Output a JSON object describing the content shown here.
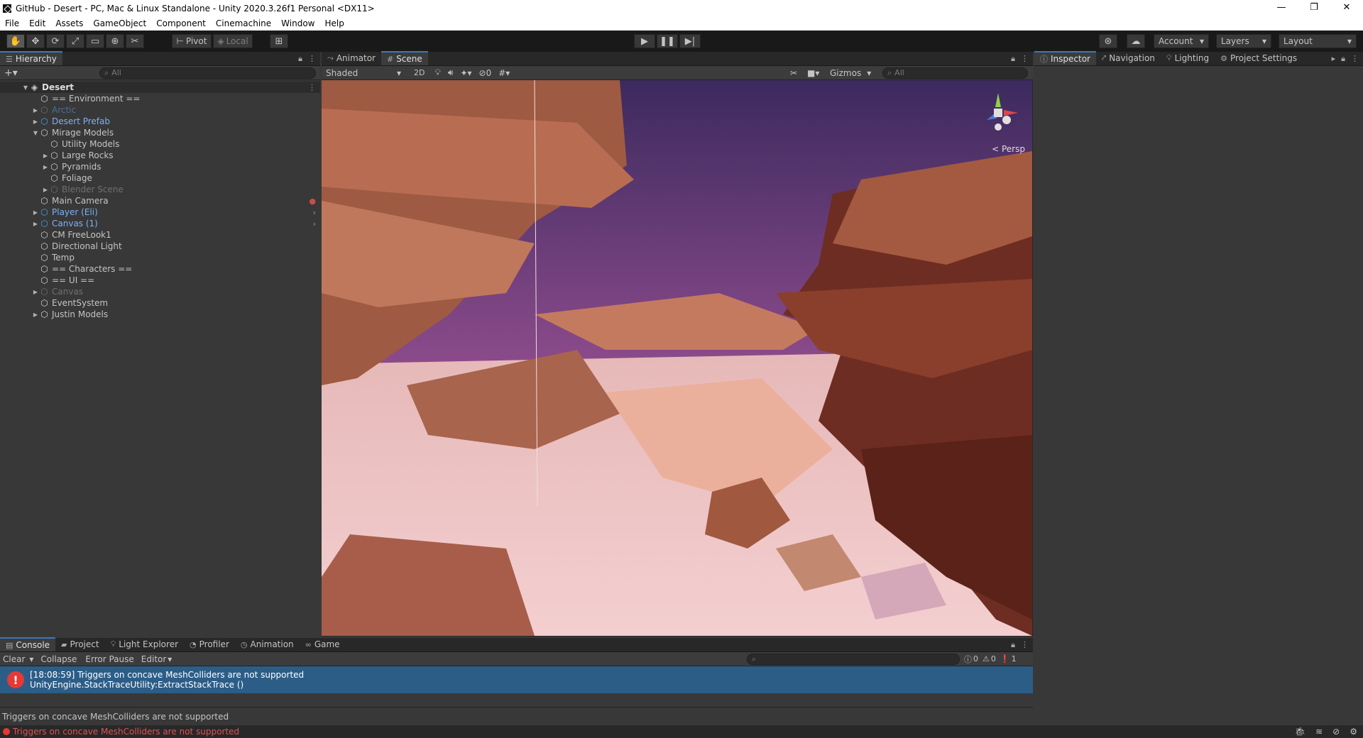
{
  "window": {
    "title": "GitHub - Desert - PC, Mac & Linux Standalone - Unity 2020.3.26f1 Personal <DX11>"
  },
  "menu": [
    "File",
    "Edit",
    "Assets",
    "GameObject",
    "Component",
    "Cinemachine",
    "Window",
    "Help"
  ],
  "toolbar": {
    "pivot": "Pivot",
    "local": "Local",
    "account": "Account",
    "layers": "Layers",
    "layout": "Layout"
  },
  "hierarchy": {
    "tab": "Hierarchy",
    "search_placeholder": "All",
    "scene": "Desert",
    "items": [
      {
        "label": "== Environment ==",
        "depth": 1,
        "arrow": "",
        "style": ""
      },
      {
        "label": "Arctic",
        "depth": 1,
        "arrow": "▶",
        "style": "faded blue"
      },
      {
        "label": "Desert Prefab",
        "depth": 1,
        "arrow": "▶",
        "style": "blue"
      },
      {
        "label": "Mirage Models",
        "depth": 1,
        "arrow": "▼",
        "style": ""
      },
      {
        "label": "Utility Models",
        "depth": 2,
        "arrow": "",
        "style": ""
      },
      {
        "label": "Large Rocks",
        "depth": 2,
        "arrow": "▶",
        "style": ""
      },
      {
        "label": "Pyramids",
        "depth": 2,
        "arrow": "▶",
        "style": ""
      },
      {
        "label": "Foliage",
        "depth": 2,
        "arrow": "",
        "style": ""
      },
      {
        "label": "Blender Scene",
        "depth": 2,
        "arrow": "▶",
        "style": "faded"
      },
      {
        "label": "Main Camera",
        "depth": 1,
        "arrow": "",
        "style": ""
      },
      {
        "label": "Player (Eli)",
        "depth": 1,
        "arrow": "▶",
        "style": "blue"
      },
      {
        "label": "Canvas (1)",
        "depth": 1,
        "arrow": "▶",
        "style": "blue"
      },
      {
        "label": "CM FreeLook1",
        "depth": 1,
        "arrow": "",
        "style": ""
      },
      {
        "label": "Directional Light",
        "depth": 1,
        "arrow": "",
        "style": ""
      },
      {
        "label": "Temp",
        "depth": 1,
        "arrow": "",
        "style": ""
      },
      {
        "label": "== Characters ==",
        "depth": 1,
        "arrow": "",
        "style": ""
      },
      {
        "label": "== UI ==",
        "depth": 1,
        "arrow": "",
        "style": ""
      },
      {
        "label": "Canvas",
        "depth": 1,
        "arrow": "▶",
        "style": "faded"
      },
      {
        "label": "EventSystem",
        "depth": 1,
        "arrow": "",
        "style": ""
      },
      {
        "label": "Justin Models",
        "depth": 1,
        "arrow": "▶",
        "style": ""
      }
    ]
  },
  "scene_tabs": {
    "animator": "Animator",
    "scene": "Scene"
  },
  "scene_bar": {
    "shading": "Shaded",
    "mode2d": "2D",
    "hidden_count": "0",
    "gizmos": "Gizmos",
    "search_placeholder": "All",
    "persp": "< Persp"
  },
  "right_tabs": {
    "inspector": "Inspector",
    "navigation": "Navigation",
    "lighting": "Lighting",
    "project_settings": "Project Settings"
  },
  "bottom_tabs": [
    "Console",
    "Project",
    "Light Explorer",
    "Profiler",
    "Animation",
    "Game"
  ],
  "console": {
    "clear": "Clear",
    "collapse": "Collapse",
    "error_pause": "Error Pause",
    "editor": "Editor",
    "log_count": "0",
    "warn_count": "0",
    "error_count": "1",
    "entry_line1": "[18:08:59] Triggers on concave MeshColliders are not supported",
    "entry_line2": "UnityEngine.StackTraceUtility:ExtractStackTrace ()",
    "detail": "Triggers on concave MeshColliders are not supported"
  },
  "status": {
    "message": "Triggers on concave MeshColliders are not supported"
  }
}
